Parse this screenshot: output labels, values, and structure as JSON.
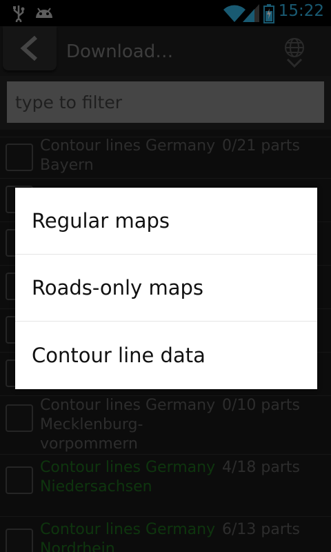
{
  "status_bar": {
    "time": "15:22",
    "icons": [
      "usb-icon",
      "android-icon",
      "wifi-icon",
      "signal-icon",
      "battery-charging-icon"
    ]
  },
  "title_bar": {
    "title": "Download…",
    "back_icon": "chevron-left-icon",
    "action_icon": "globe-download-icon"
  },
  "filter": {
    "placeholder": "type to filter",
    "value": ""
  },
  "list": {
    "items": [
      {
        "name": "Contour lines Germany Bayern",
        "parts": "0/21 parts",
        "downloaded": false
      },
      {
        "name": "Contour lines Germany Mecklenburg-vorpommern",
        "parts": "0/10 parts",
        "downloaded": false
      },
      {
        "name": "Contour lines Germany Niedersachsen",
        "parts": "4/18 parts",
        "downloaded": true
      },
      {
        "name": "Contour lines Germany Nordrhein",
        "parts": "6/13 parts",
        "downloaded": true
      }
    ]
  },
  "dialog": {
    "options": [
      "Regular maps",
      "Roads-only maps",
      "Contour line data"
    ]
  }
}
